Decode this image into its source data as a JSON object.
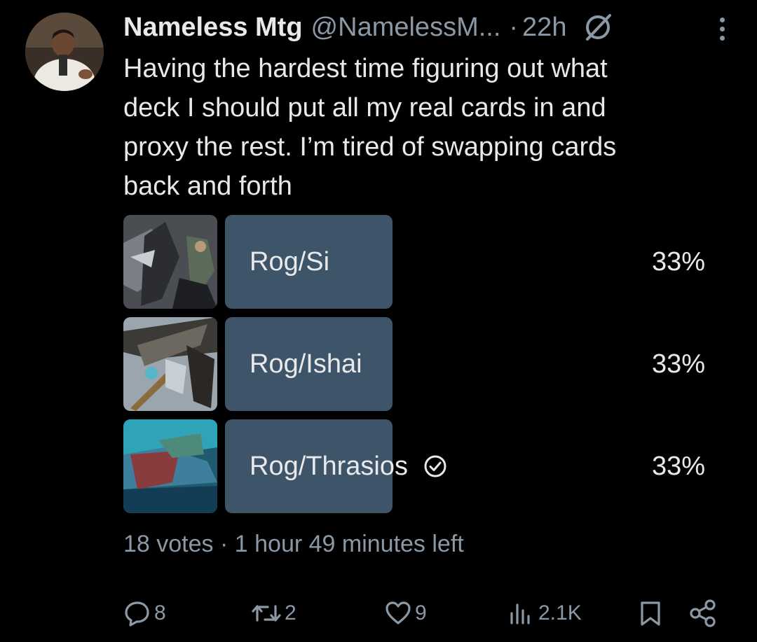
{
  "tweet": {
    "author_name": "Nameless Mtg",
    "handle": "@NamelessM...",
    "separator": "·",
    "time": "22h",
    "text": "Having the hardest time figuring out what\ndeck I should put all my real cards in and\nproxy the rest. I’m tired of swapping cards\nback and forth"
  },
  "poll": {
    "options": [
      {
        "label": "Rog/Si",
        "percent": "33%",
        "fraction": 0.333,
        "selected": false
      },
      {
        "label": "Rog/Ishai",
        "percent": "33%",
        "fraction": 0.333,
        "selected": false
      },
      {
        "label": "Rog/Thrasios",
        "percent": "33%",
        "fraction": 0.333,
        "selected": true
      }
    ],
    "votes": "18 votes",
    "meta_separator": "·",
    "time_left": "1 hour 49 minutes left"
  },
  "actions": {
    "replies": "8",
    "reposts": "2",
    "likes": "9",
    "views": "2.1K"
  },
  "colors": {
    "background": "#000000",
    "text": "#e7e9ea",
    "muted": "#8b98a5",
    "poll_bar": "#3e5468"
  },
  "icons": [
    "grok-icon",
    "more-icon",
    "check-circle-icon",
    "reply-icon",
    "repost-icon",
    "like-icon",
    "views-icon",
    "bookmark-icon",
    "share-icon"
  ]
}
